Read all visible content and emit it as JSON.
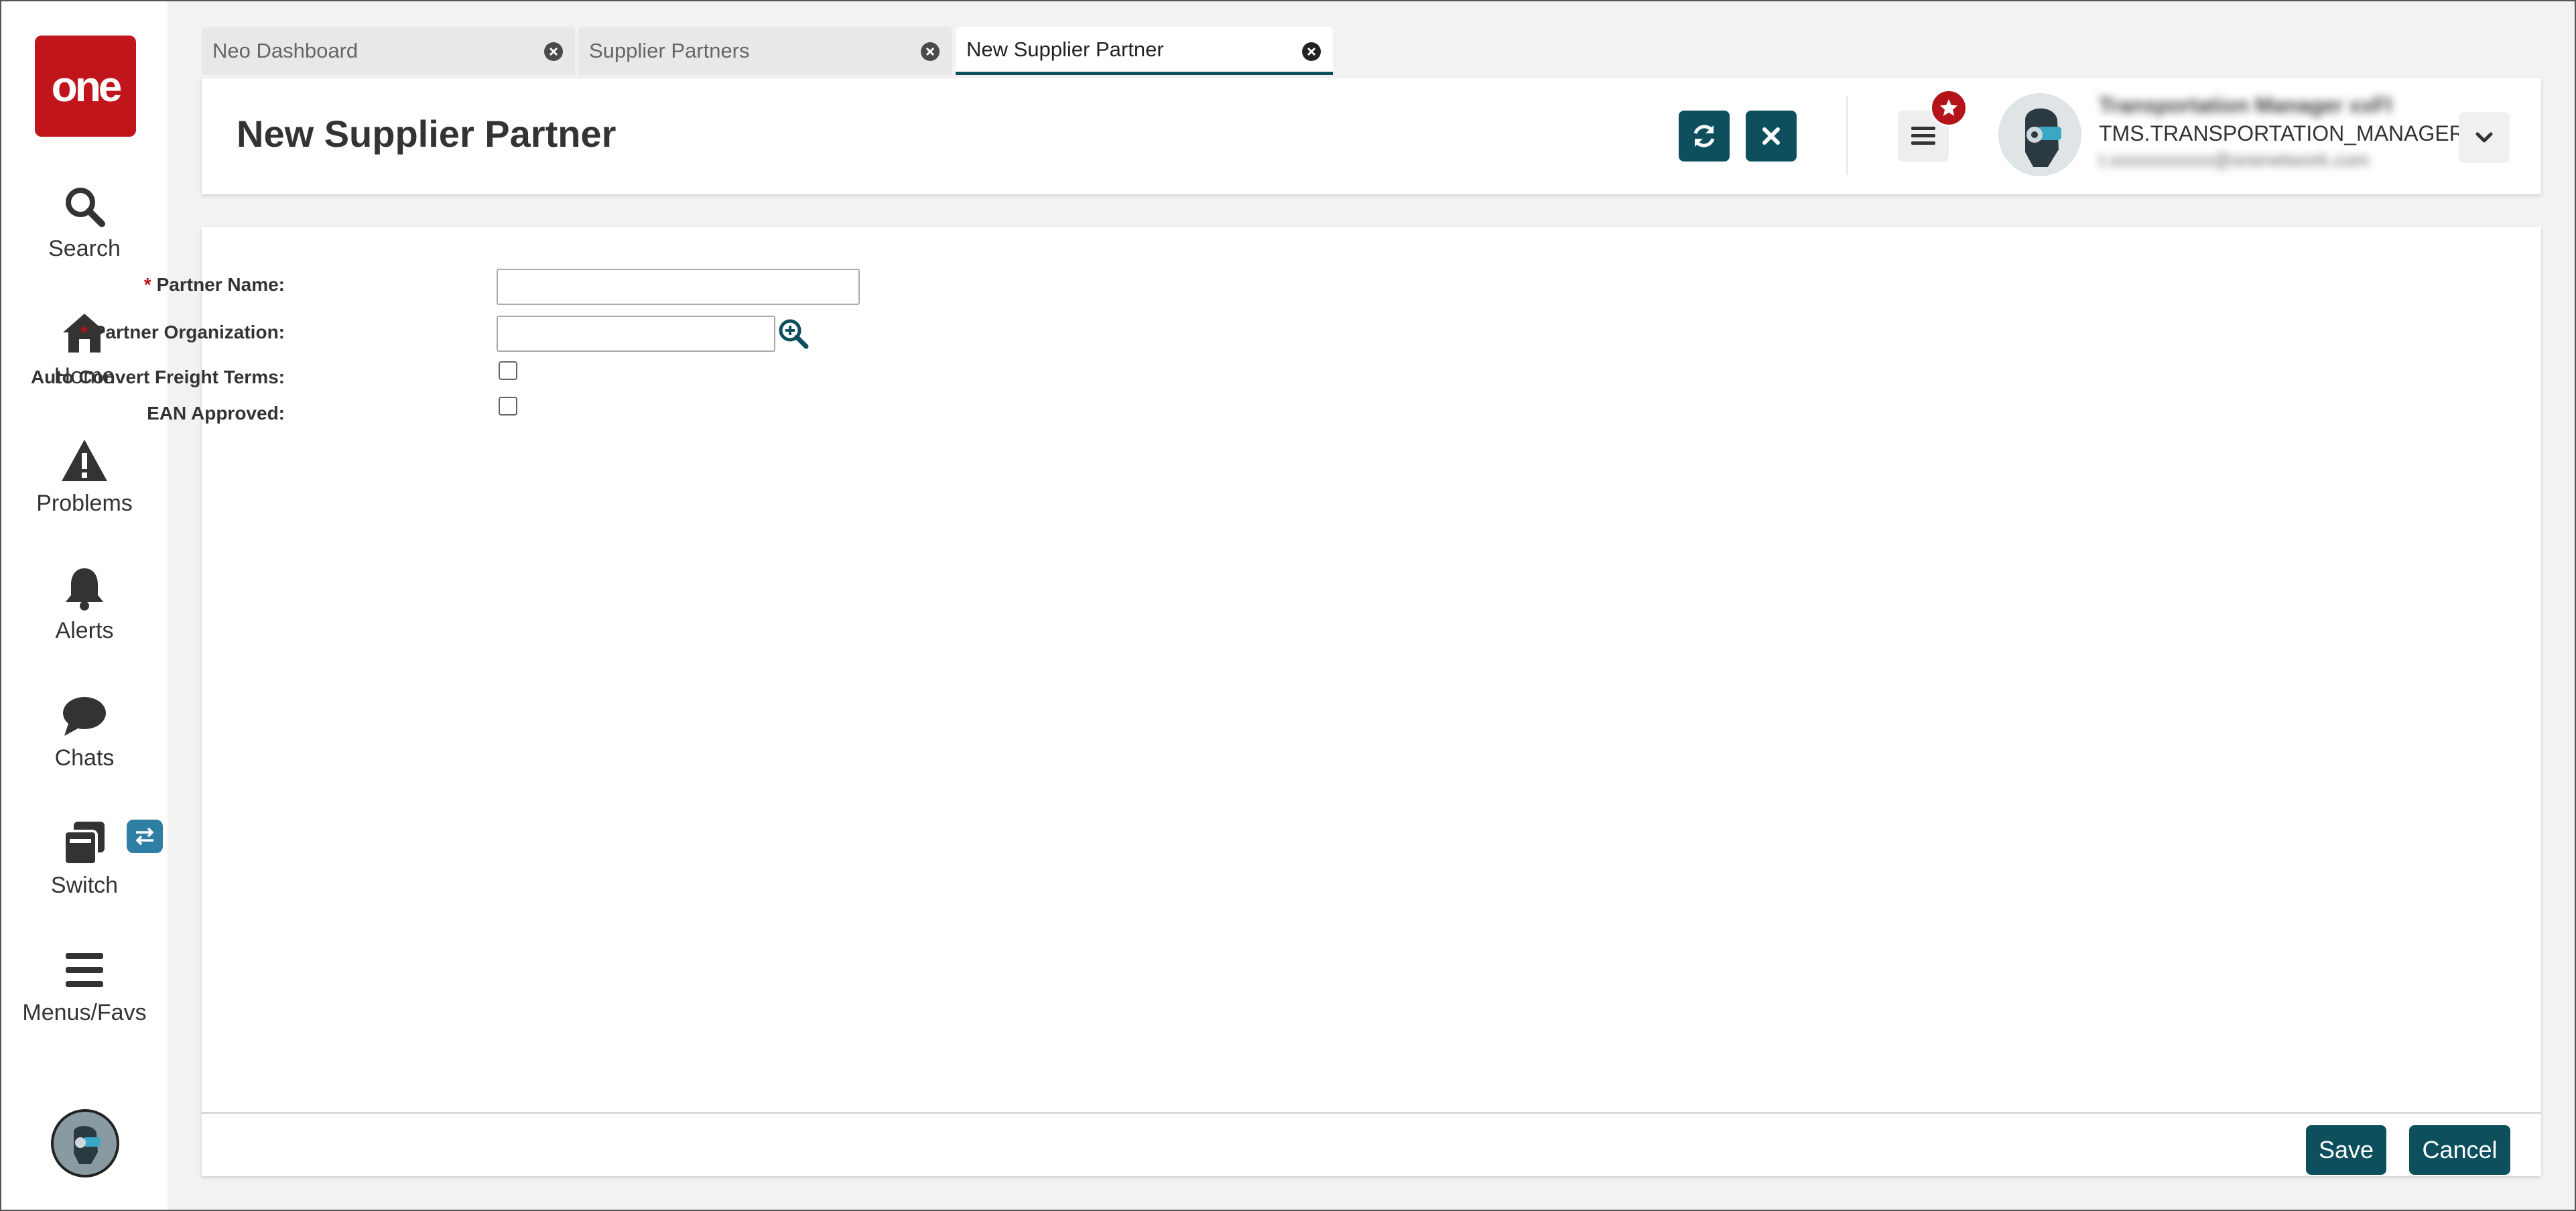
{
  "brand": {
    "logo_text": "one",
    "color": "#c0151b"
  },
  "nav": [
    {
      "label": "Search",
      "icon": "search-icon"
    },
    {
      "label": "Home",
      "icon": "home-icon"
    },
    {
      "label": "Problems",
      "icon": "warning-icon"
    },
    {
      "label": "Alerts",
      "icon": "bell-icon"
    },
    {
      "label": "Chats",
      "icon": "chat-icon"
    },
    {
      "label": "Switch",
      "icon": "switch-icon"
    },
    {
      "label": "Menus/Favs",
      "icon": "menu-icon"
    }
  ],
  "tabs": [
    {
      "label": "Neo Dashboard",
      "active": false
    },
    {
      "label": "Supplier Partners",
      "active": false
    },
    {
      "label": "New Supplier Partner",
      "active": true
    }
  ],
  "header": {
    "title": "New Supplier Partner",
    "user": {
      "name": "Transportation Manager xxFl",
      "role": "TMS.TRANSPORTATION_MANAGER",
      "email": "t.xxxxxxxxxxx@onenetwork.com"
    }
  },
  "form": {
    "partner_name": {
      "label": "Partner Name:",
      "required": true,
      "value": ""
    },
    "partner_org": {
      "label": "Partner Organization:",
      "required": true,
      "value": ""
    },
    "auto_convert": {
      "label": "Auto Convert Freight Terms:",
      "checked": false
    },
    "ean_approved": {
      "label": "EAN Approved:",
      "checked": false
    }
  },
  "footer": {
    "save_label": "Save",
    "cancel_label": "Cancel"
  },
  "colors": {
    "accent": "#0d4f5c",
    "required": "#b3141a"
  }
}
